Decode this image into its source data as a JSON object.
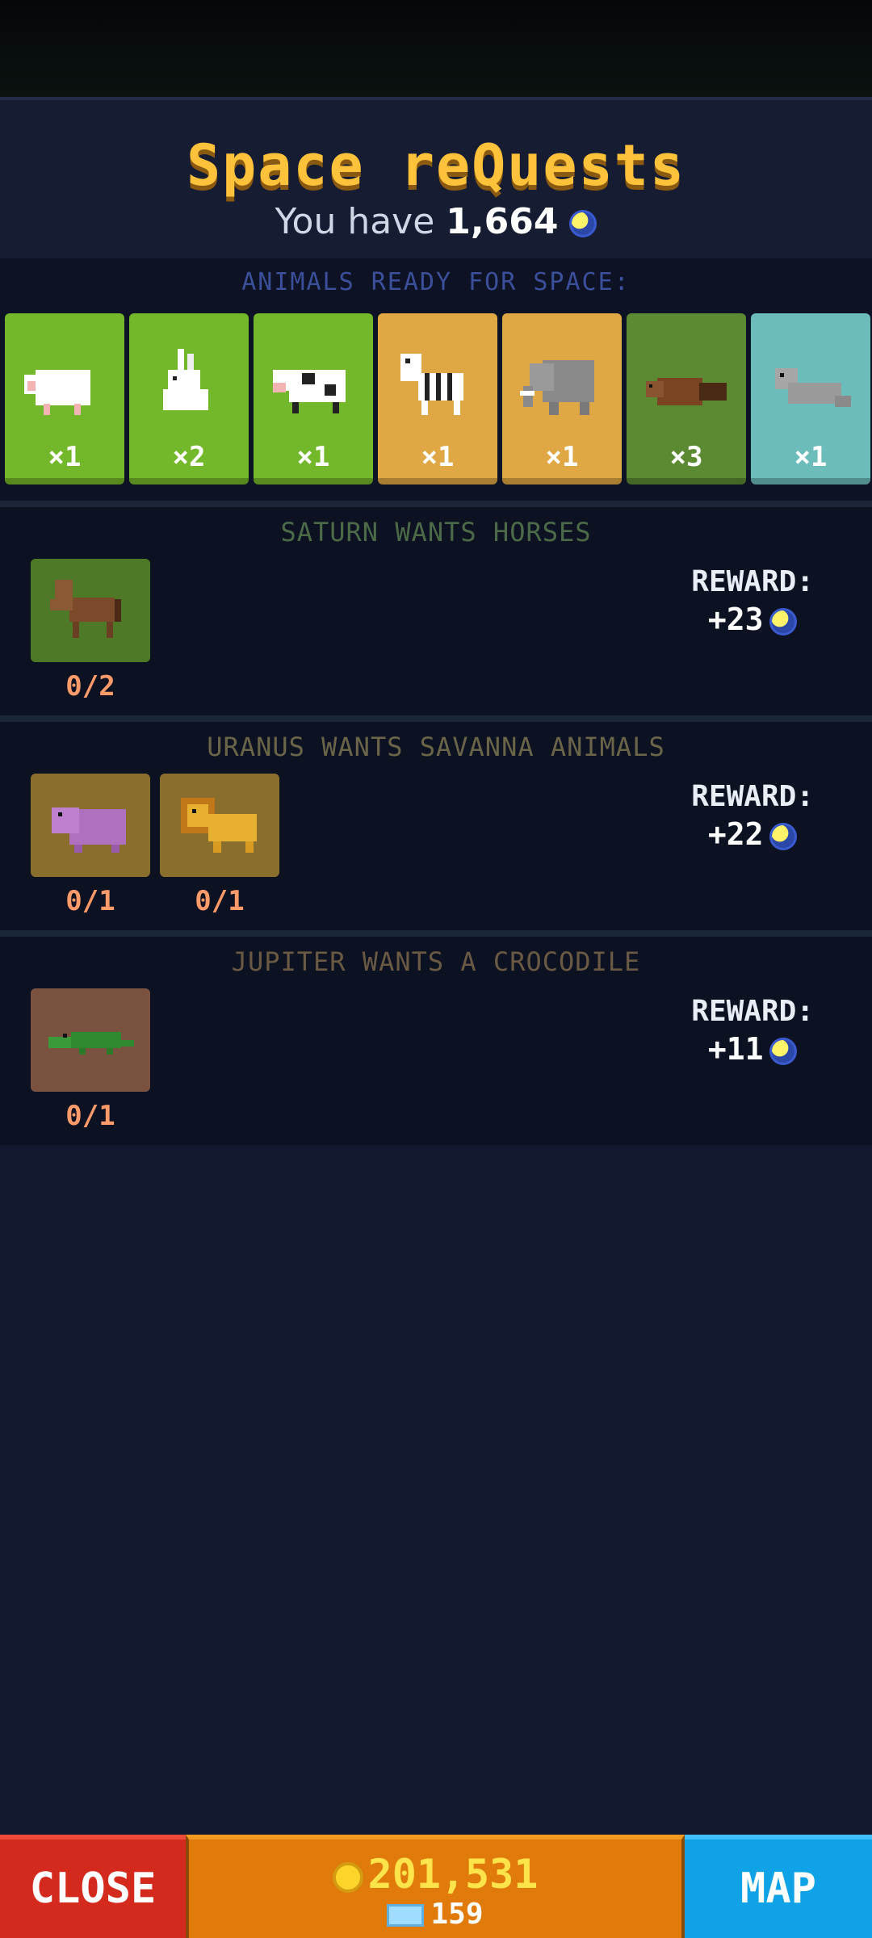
{
  "header": {
    "title": "Space reQuests",
    "balance_prefix": "You have",
    "balance_value": "1,664",
    "currency_icon": "moon-icon"
  },
  "ready": {
    "label": "ANIMALS READY FOR SPACE:",
    "cards": [
      {
        "animal": "sheep",
        "icon": "sheep-icon",
        "count": "×1",
        "bg": "#73b82a"
      },
      {
        "animal": "rabbit",
        "icon": "rabbit-icon",
        "count": "×2",
        "bg": "#73b82a"
      },
      {
        "animal": "cow",
        "icon": "cow-icon",
        "count": "×1",
        "bg": "#73b82a"
      },
      {
        "animal": "zebra",
        "icon": "zebra-icon",
        "count": "×1",
        "bg": "#e0a844"
      },
      {
        "animal": "elephant",
        "icon": "elephant-icon",
        "count": "×1",
        "bg": "#e0a844"
      },
      {
        "animal": "beaver",
        "icon": "beaver-icon",
        "count": "×3",
        "bg": "#5c8a32"
      },
      {
        "animal": "seal",
        "icon": "seal-icon",
        "count": "×1",
        "bg": "#6cbcbc"
      }
    ]
  },
  "requests": [
    {
      "title": "SATURN WANTS HORSES",
      "title_color": "#4c6a48",
      "reward_label": "REWARD:",
      "reward_value": "+23",
      "slots": [
        {
          "animal": "horse",
          "icon": "horse-icon",
          "progress": "0/2",
          "bg": "#4e7a28"
        }
      ]
    },
    {
      "title": "URANUS WANTS SAVANNA ANIMALS",
      "title_color": "#6a6448",
      "reward_label": "REWARD:",
      "reward_value": "+22",
      "slots": [
        {
          "animal": "hippo",
          "icon": "hippo-icon",
          "progress": "0/1",
          "bg": "#8a6e2e"
        },
        {
          "animal": "lion",
          "icon": "lion-icon",
          "progress": "0/1",
          "bg": "#8a6e2e"
        }
      ]
    },
    {
      "title": "JUPITER WANTS A CROCODILE",
      "title_color": "#6a5a44",
      "reward_label": "REWARD:",
      "reward_value": "+11",
      "slots": [
        {
          "animal": "crocodile",
          "icon": "crocodile-icon",
          "progress": "0/1",
          "bg": "#7a5240"
        }
      ]
    }
  ],
  "footer": {
    "close_label": "CLOSE",
    "coins": "201,531",
    "gems": "159",
    "map_label": "MAP"
  }
}
